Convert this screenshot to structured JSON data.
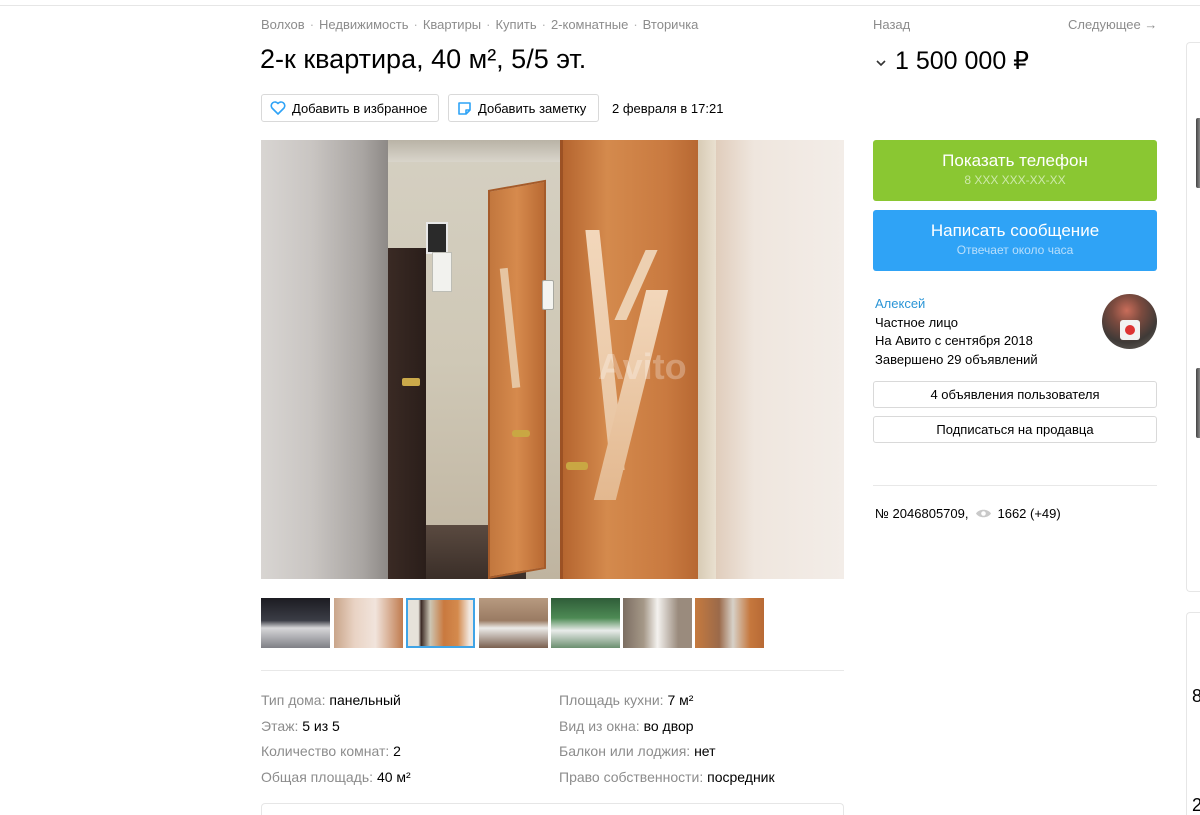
{
  "breadcrumbs": [
    "Волхов",
    "Недвижимость",
    "Квартиры",
    "Купить",
    "2-комнатные",
    "Вторичка"
  ],
  "listing": {
    "title": "2-к квартира, 40 м², 5/5 эт.",
    "favorite_label": "Добавить в избранное",
    "note_label": "Добавить заметку",
    "posted": "2 февраля в 17:21",
    "watermark": "Avito"
  },
  "gallery": {
    "active_index": 2,
    "thumbs": [
      "thumb-1",
      "thumb-2",
      "thumb-3",
      "thumb-4",
      "thumb-5",
      "thumb-6",
      "thumb-7"
    ]
  },
  "params": {
    "left": [
      {
        "label": "Тип дома:",
        "value": "панельный"
      },
      {
        "label": "Этаж:",
        "value": "5 из 5"
      },
      {
        "label": "Количество комнат:",
        "value": "2"
      },
      {
        "label": "Общая площадь:",
        "value": "40 м²"
      }
    ],
    "right": [
      {
        "label": "Площадь кухни:",
        "value": "7 м²"
      },
      {
        "label": "Вид из окна:",
        "value": "во двор"
      },
      {
        "label": "Балкон или лоджия:",
        "value": "нет"
      },
      {
        "label": "Право собственности:",
        "value": "посредник"
      }
    ]
  },
  "nav": {
    "back": "Назад",
    "next": "Следующее →"
  },
  "price": "1 500 000 ₽",
  "phone_button": {
    "label": "Показать телефон",
    "sub": "8 XXX XXX-XX-XX"
  },
  "message_button": {
    "label": "Написать сообщение",
    "sub": "Отвечает около часа"
  },
  "seller": {
    "name": "Алексей",
    "type": "Частное лицо",
    "since": "На Авито с сентября 2018",
    "completed": "Завершено 29 объявлений"
  },
  "seller_buttons": {
    "listings": "4 объявления пользователя",
    "subscribe": "Подписаться на продавца"
  },
  "ad": {
    "number": "№ 2046805709,",
    "views": "1662 (+49)"
  },
  "edge": {
    "num1": "8",
    "num2": "2"
  },
  "colors": {
    "green": "#8ac732",
    "blue": "#2fa3f6",
    "link": "#2b95d6"
  }
}
